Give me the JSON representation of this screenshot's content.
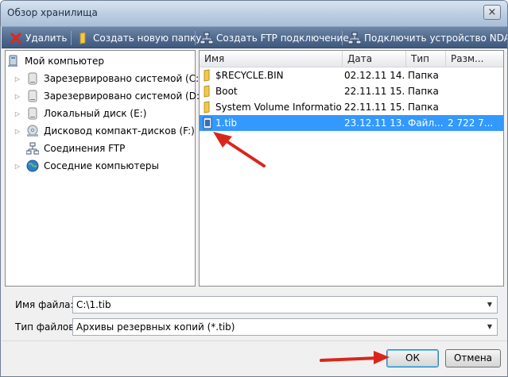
{
  "window": {
    "title": "Обзор хранилища",
    "close_glyph": "×"
  },
  "toolbar": {
    "delete_label": "Удалить",
    "new_folder_label": "Создать новую папку",
    "ftp_label": "Создать FTP подключение",
    "nas_label": "Подключить устройство NDAS"
  },
  "tree": {
    "root_label": "Мой компьютер",
    "items": [
      {
        "label": "Зарезервировано системой (C:)",
        "icon": "hard-drive-icon"
      },
      {
        "label": "Зарезервировано системой (D:)",
        "icon": "hard-drive-icon"
      },
      {
        "label": "Локальный диск (E:)",
        "icon": "hard-drive-icon"
      },
      {
        "label": "Дисковод компакт-дисков (F:)",
        "icon": "cd-drive-icon"
      },
      {
        "label": "Соединения FTP",
        "icon": "ftp-icon"
      },
      {
        "label": "Соседние компьютеры",
        "icon": "network-icon"
      }
    ]
  },
  "files": {
    "columns": {
      "name": "Имя",
      "date": "Дата",
      "type": "Тип",
      "size": "Разм..."
    },
    "rows": [
      {
        "name": "$RECYCLE.BIN",
        "date": "02.12.11 14...",
        "type": "Папка",
        "size": ""
      },
      {
        "name": "Boot",
        "date": "22.11.11 15...",
        "type": "Папка",
        "size": ""
      },
      {
        "name": "System Volume Information",
        "date": "22.11.11 15...",
        "type": "Папка",
        "size": ""
      },
      {
        "name": "1.tib",
        "date": "23.12.11 13...",
        "type": "Файл...",
        "size": "2 722 7..."
      }
    ]
  },
  "form": {
    "filename_label": "Имя файла:",
    "filename_value": "C:\\1.tib",
    "filetype_label": "Тип файлов:",
    "filetype_value": "Архивы резервных копий (*.tib)"
  },
  "buttons": {
    "ok_label": "ОК",
    "cancel_label": "Отмена"
  },
  "colors": {
    "selection": "#3399ff",
    "toolbar": "#4f6a8e",
    "annotation_arrow": "#d9261c"
  }
}
